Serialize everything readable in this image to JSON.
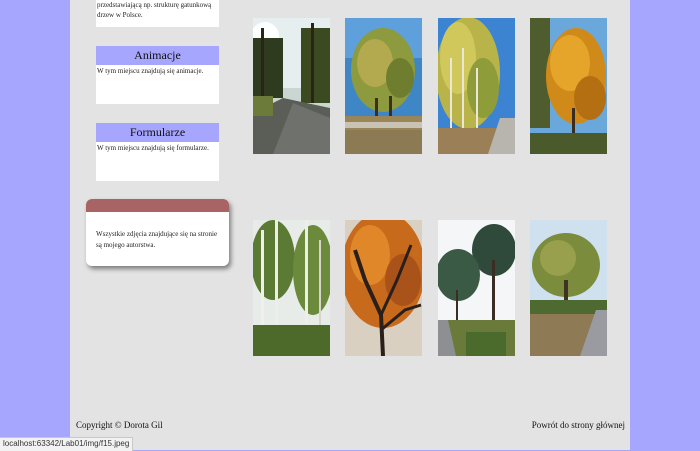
{
  "intro": {
    "text": "przedstawiającą np. strukturę gatunkową drzew w Polsce."
  },
  "sidebar": {
    "animations": {
      "heading": "Animacje",
      "text": "W tym miejscu znajdują się animacje."
    },
    "forms": {
      "heading": "Formularze",
      "text": "W tym miejscu znajdują się formularze."
    }
  },
  "note": {
    "text": "Wszystkie zdjęcia znajdujące się na stronie są mojego autorstwa."
  },
  "gallery": {
    "photos": [
      "sunlit-forest-road",
      "birch-meadow-blue-sky",
      "yellow-birches-road",
      "orange-autumn-tree",
      "tall-birch-forest",
      "red-leaves-canopy",
      "pines-along-road",
      "oak-by-country-road"
    ]
  },
  "footer": {
    "copyright": "Copyright © Dorota Gil",
    "home_link": "Powrót do strony głównej"
  },
  "status_bar": {
    "url": "localhost:63342/Lab01/img/f15.jpeg"
  },
  "colors": {
    "background": "#a6a6ff",
    "content": "#e3e3e3",
    "heading_bar": "#a6a6ff",
    "note_bar": "#a86464"
  }
}
